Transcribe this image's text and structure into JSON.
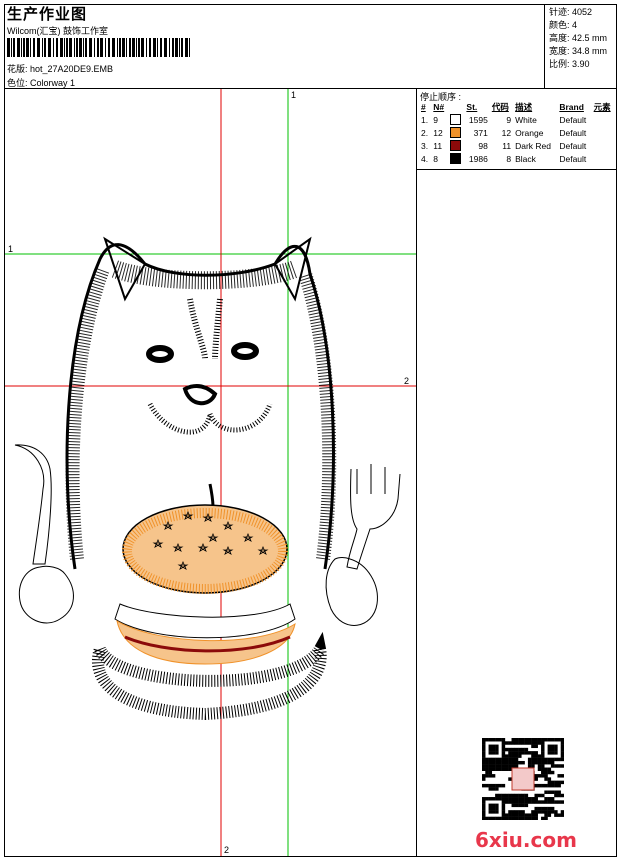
{
  "header": {
    "title": "生产作业图",
    "company": "Wilcom(汇宝) 鼓饰工作室",
    "design_name": "花版: hot_27A20DE9.EMB",
    "colorway": "色位: Colorway 1"
  },
  "stats": {
    "stitches": "针迹: 4052",
    "colors": "颜色: 4",
    "height": "高度: 42.5 mm",
    "width": "宽度: 34.8 mm",
    "scale": "比例: 3.90"
  },
  "sequence": {
    "heading": "停止顺序 :",
    "columns": [
      "#",
      "N#",
      "St.",
      "代码",
      "描述",
      "Brand",
      "元素"
    ],
    "rows": [
      {
        "idx": "1.",
        "n": "9",
        "color": "#ffffff",
        "st": "1595",
        "code": "9",
        "desc": "White",
        "brand": "Default"
      },
      {
        "idx": "2.",
        "n": "12",
        "color": "#f0922a",
        "st": "371",
        "code": "12",
        "desc": "Orange",
        "brand": "Default"
      },
      {
        "idx": "3.",
        "n": "11",
        "color": "#8b0a0a",
        "st": "98",
        "code": "11",
        "desc": "Dark Red",
        "brand": "Default"
      },
      {
        "idx": "4.",
        "n": "8",
        "color": "#000000",
        "st": "1986",
        "code": "8",
        "desc": "Black",
        "brand": "Default"
      }
    ]
  },
  "guides": {
    "green_vertical_label": "1",
    "green_horizontal_label": "1",
    "red_horizontal_label": "2",
    "red_vertical_label": "2"
  },
  "watermark": {
    "site": "6xiu.com"
  }
}
